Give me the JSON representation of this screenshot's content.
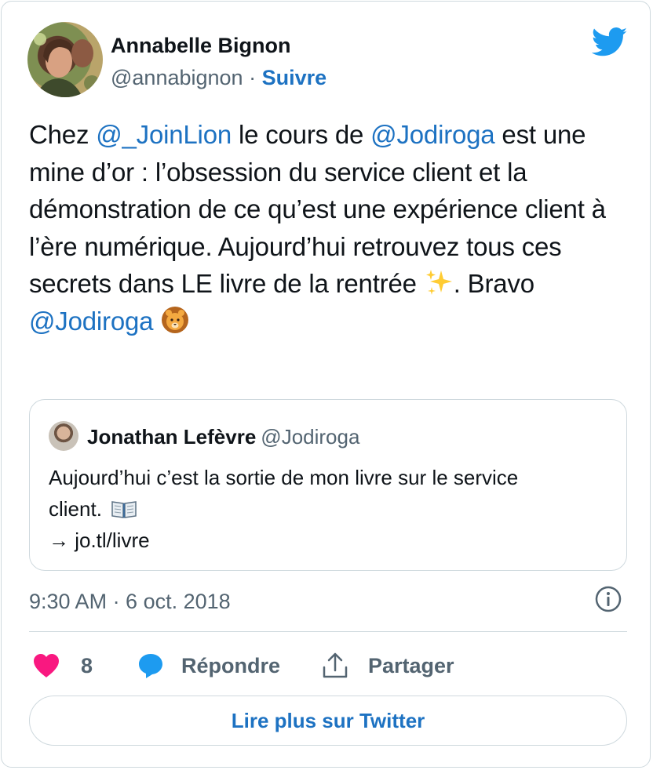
{
  "author": {
    "name": "Annabelle Bignon",
    "handle": "@annabignon",
    "separator": "·",
    "follow_label": "Suivre"
  },
  "icons": {
    "brand": "twitter-bird-icon",
    "brand_color": "#1d9bf0",
    "link_color": "#1d72c2",
    "like_color": "#f91880"
  },
  "tweet": {
    "text_parts": [
      {
        "t": "Chez ",
        "mention": false
      },
      {
        "t": "@_JoinLion",
        "mention": true
      },
      {
        "t": " le cours de ",
        "mention": false
      },
      {
        "t": "@Jodiroga",
        "mention": true
      },
      {
        "t": " est une mine d’or : l’obsession du service client et la démonstration de ce qu’est une expérience client à l’ère numérique. Aujourd’hui retrouvez tous ces secrets dans LE livre de la rentrée ",
        "mention": false
      },
      {
        "t": "sparkles-emoji",
        "emoji": true
      },
      {
        "t": ". Bravo ",
        "mention": false
      },
      {
        "t": "@Jodiroga",
        "mention": true
      },
      {
        "t": " ",
        "mention": false
      },
      {
        "t": "lion-emoji",
        "emoji": true
      }
    ]
  },
  "quoted": {
    "name": "Jonathan Lefèvre",
    "handle": "@Jodiroga",
    "text_line1": "Aujourd’hui c’est la sortie de mon livre sur le service",
    "text_line2": "client.",
    "text_line3": "→ jo.tl/livre"
  },
  "meta": {
    "timestamp": "9:30 AM · 6 oct. 2018"
  },
  "actions": {
    "like_count": "8",
    "reply_label": "Répondre",
    "share_label": "Partager"
  },
  "footer": {
    "read_more_label": "Lire plus sur Twitter"
  }
}
